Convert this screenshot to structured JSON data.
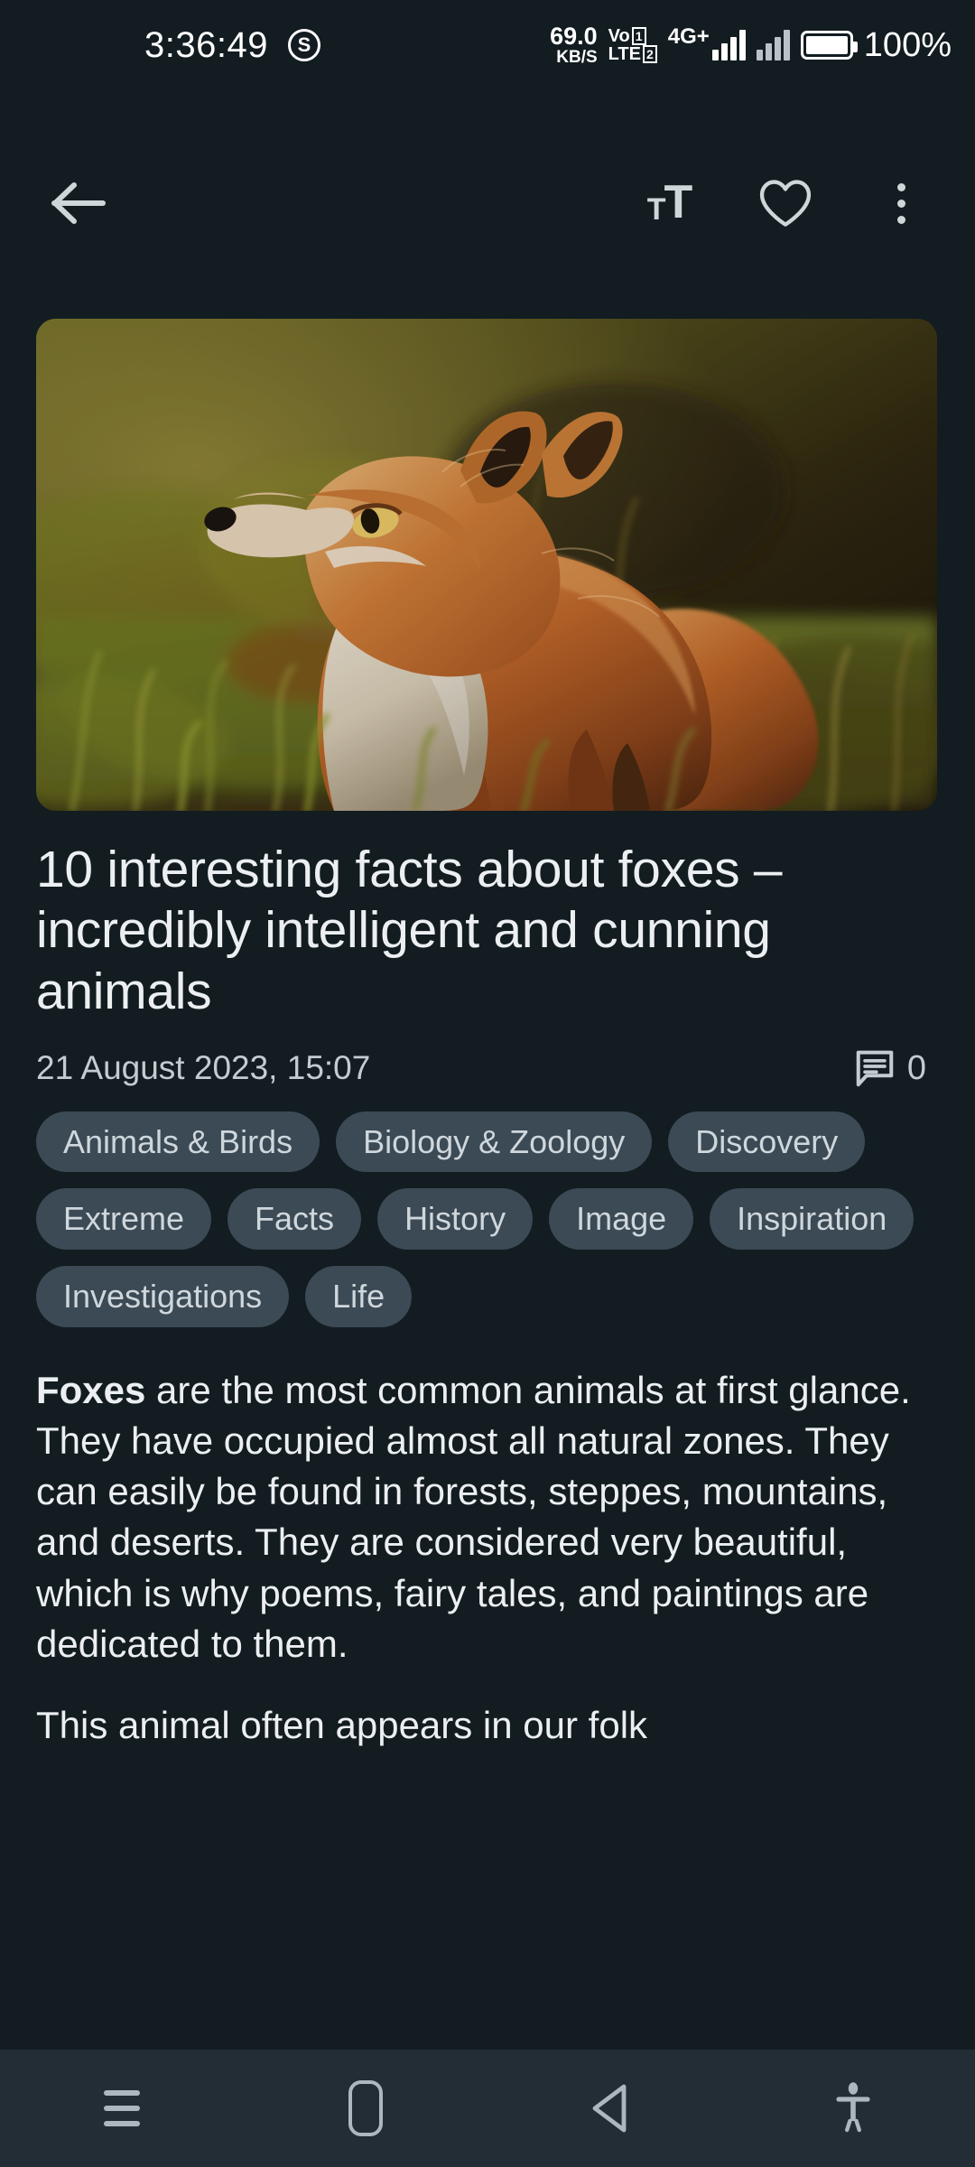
{
  "status_bar": {
    "time": "3:36:49",
    "badge_icon": "s-circle-icon",
    "badge_letter": "S",
    "net_speed_value": "69.0",
    "net_speed_unit": "KB/S",
    "volte_line1": "Vo",
    "volte_line2": "LTE",
    "sim1_number": "1",
    "sim2_number": "2",
    "network_type": "4G",
    "network_plus": "+",
    "signal_icon": "signal-bars-icon",
    "battery_icon": "battery-full-icon",
    "battery_percent": "100%"
  },
  "toolbar": {
    "back_icon": "arrow-left-icon",
    "font_size_small": "T",
    "font_size_large": "T",
    "font_size_icon": "text-size-icon",
    "favorite_icon": "heart-outline-icon",
    "overflow_icon": "three-dot-menu-icon"
  },
  "hero": {
    "image_alt": "red fox standing in autumn grass looking upward",
    "icon": "article-hero-image"
  },
  "article": {
    "title": "10 interesting facts about foxes – incredibly intelligent and cunning animals",
    "date": "21 August 2023, 15:07",
    "comments_icon": "comment-bubble-icon",
    "comments_count": "0",
    "tags": [
      "Animals & Birds",
      "Biology & Zoology",
      "Discovery",
      "Extreme",
      "Facts",
      "History",
      "Image",
      "Inspiration",
      "Investigations",
      "Life"
    ],
    "paragraph_1_lead": "Foxes",
    "paragraph_1_rest": " are the most common animals at first glance. They have occupied almost all natural zones. They can easily be found in forests, steppes, mountains, and deserts. They are considered very beautiful, which is why poems, fairy tales, and paintings are dedicated to them.",
    "paragraph_2": "This animal often appears in our folk"
  },
  "nav_bar": {
    "recents_icon": "recent-apps-icon",
    "home_icon": "home-icon",
    "back_icon": "back-triangle-icon",
    "accessibility_icon": "accessibility-person-icon"
  },
  "colors": {
    "background": "#121c21",
    "nav_bar": "#232d35",
    "tag_pill": "#3b4a55",
    "text_primary": "#eceff1",
    "text_secondary": "#c4ccd1",
    "icon": "#cfd6da"
  }
}
